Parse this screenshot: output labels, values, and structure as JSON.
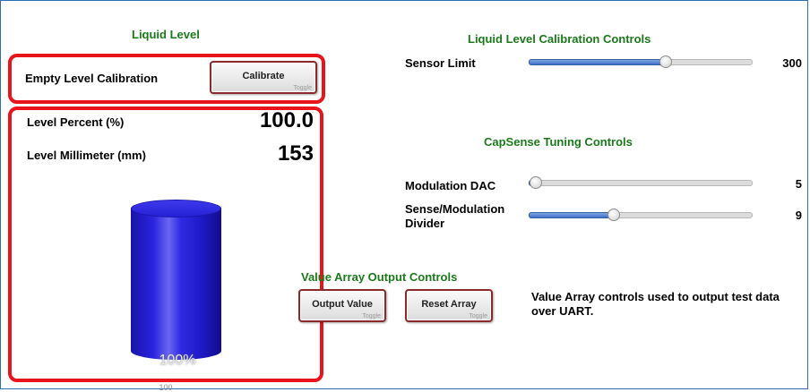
{
  "liquid_level": {
    "title": "Liquid Level",
    "empty_calibration_label": "Empty Level Calibration",
    "calibrate_button": {
      "label": "Calibrate",
      "sub": "Toggle"
    },
    "level_percent_label": "Level Percent (%)",
    "level_percent_value": "100.0",
    "level_mm_label": "Level Millimeter (mm)",
    "level_mm_value": "153",
    "tank": {
      "fill_fraction": 1.0,
      "overlay_text": "100%",
      "scale_label": "100",
      "color": "#2a24e0"
    }
  },
  "calibration_controls": {
    "title": "Liquid Level Calibration Controls",
    "sensor_limit": {
      "label": "Sensor Limit",
      "value": "300",
      "fraction": 0.61
    }
  },
  "capsense": {
    "title": "CapSense Tuning Controls",
    "modulation_dac": {
      "label": "Modulation DAC",
      "value": "5",
      "fraction": 0.03
    },
    "sense_divider": {
      "label_line1": "Sense/Modulation",
      "label_line2": "Divider",
      "value": "9",
      "fraction": 0.38
    }
  },
  "value_array": {
    "title": "Value Array Output Controls",
    "output_button": {
      "label": "Output Value",
      "sub": "Toggle"
    },
    "reset_button": {
      "label": "Reset Array",
      "sub": "Toggle"
    },
    "description": "Value Array controls used to output test data over UART."
  },
  "colors": {
    "section_title": "#1a7a1a",
    "highlight_border": "#e8141c",
    "slider_fill": "#3d6ec9",
    "frame_border": "#2d6db5"
  }
}
